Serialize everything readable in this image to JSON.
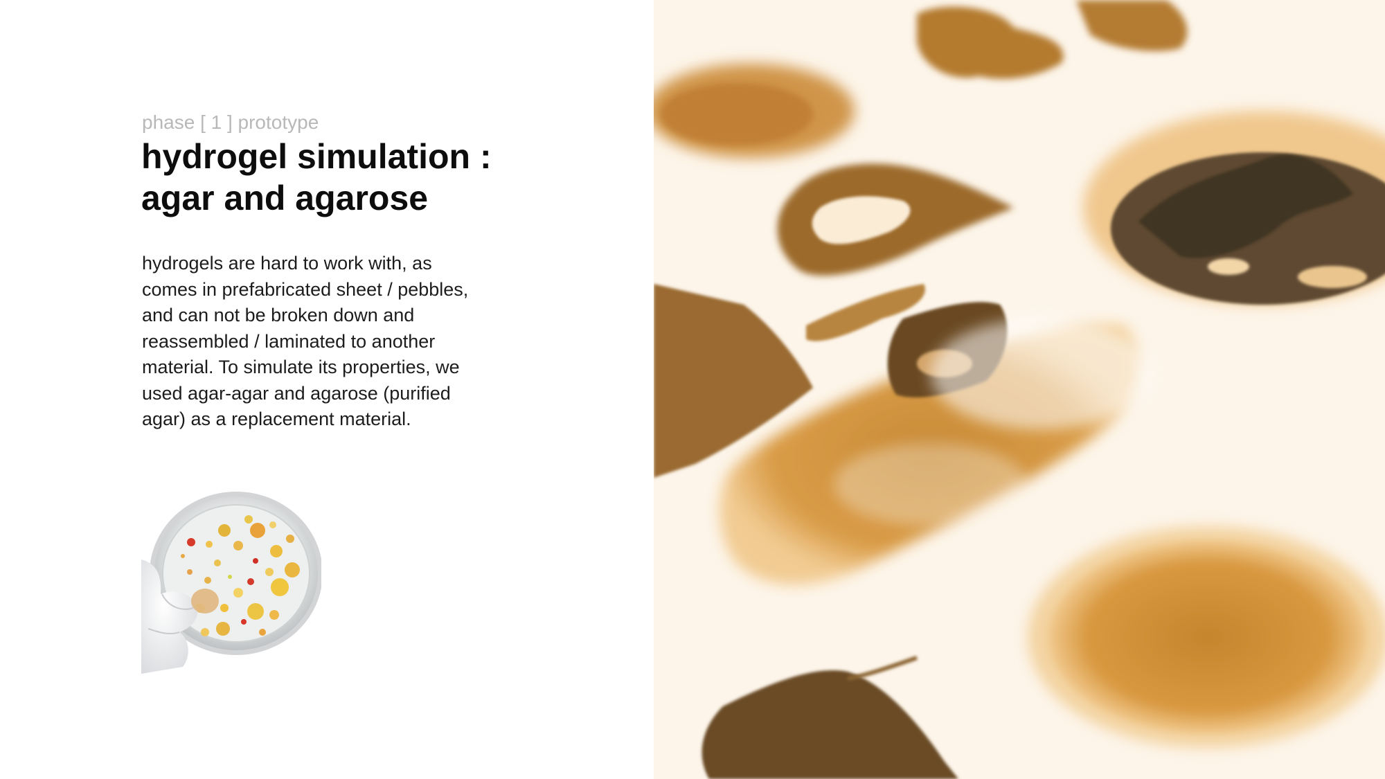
{
  "slide": {
    "subtitle": "phase [ 1 ] prototype",
    "title_lines": [
      "hydrogel simulation :",
      "agar and agarose"
    ],
    "body_lines": [
      "hydrogels are hard to work with, as",
      "comes in prefabricated sheet / pebbles,",
      "and can not be broken down and",
      "reassembled / laminated to another",
      "material. To simulate its properties, we",
      "used agar-agar and agarose (purified",
      "agar) as a replacement material."
    ]
  },
  "colors": {
    "accent_amber": "#e8a245",
    "title": "#0d0d0d",
    "subtitle": "#b8b8b8",
    "body": "#1c1c1c"
  }
}
